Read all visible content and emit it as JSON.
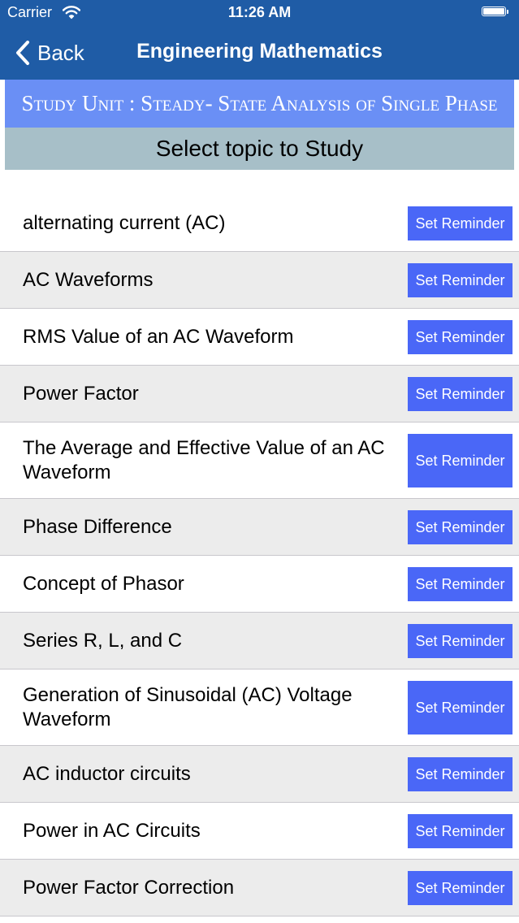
{
  "status_bar": {
    "carrier": "Carrier",
    "time": "11:26 AM"
  },
  "nav": {
    "back_label": "Back",
    "title": "Engineering Mathematics"
  },
  "unit_banner": "Study Unit : Steady- State Analysis of Single Phase",
  "select_header": "Select topic to Study",
  "topics": [
    {
      "label": "alternating current (AC)",
      "button": "Set Reminder"
    },
    {
      "label": "AC Waveforms",
      "button": "Set Reminder"
    },
    {
      "label": "RMS Value of an AC Waveform",
      "button": "Set Reminder"
    },
    {
      "label": "Power Factor",
      "button": "Set Reminder"
    },
    {
      "label": "The Average and Effective Value of an AC Waveform",
      "button": "Set Reminder"
    },
    {
      "label": "Phase Difference",
      "button": "Set Reminder"
    },
    {
      "label": "Concept of Phasor",
      "button": "Set Reminder"
    },
    {
      "label": "Series R, L, and C",
      "button": "Set Reminder"
    },
    {
      "label": "Generation of Sinusoidal (AC) Voltage Waveform",
      "button": "Set Reminder"
    },
    {
      "label": "AC inductor circuits",
      "button": "Set Reminder"
    },
    {
      "label": "Power in AC Circuits",
      "button": "Set Reminder"
    },
    {
      "label": "Power Factor Correction",
      "button": "Set Reminder"
    }
  ],
  "colors": {
    "nav_bar": "#1f5ca6",
    "unit_banner": "#6a8ff5",
    "select_header": "#a7bfc8",
    "button": "#4a67f7",
    "alt_row": "#ececec"
  },
  "icons": {
    "wifi": "wifi-icon",
    "battery": "battery-icon",
    "back": "chevron-left-icon"
  }
}
